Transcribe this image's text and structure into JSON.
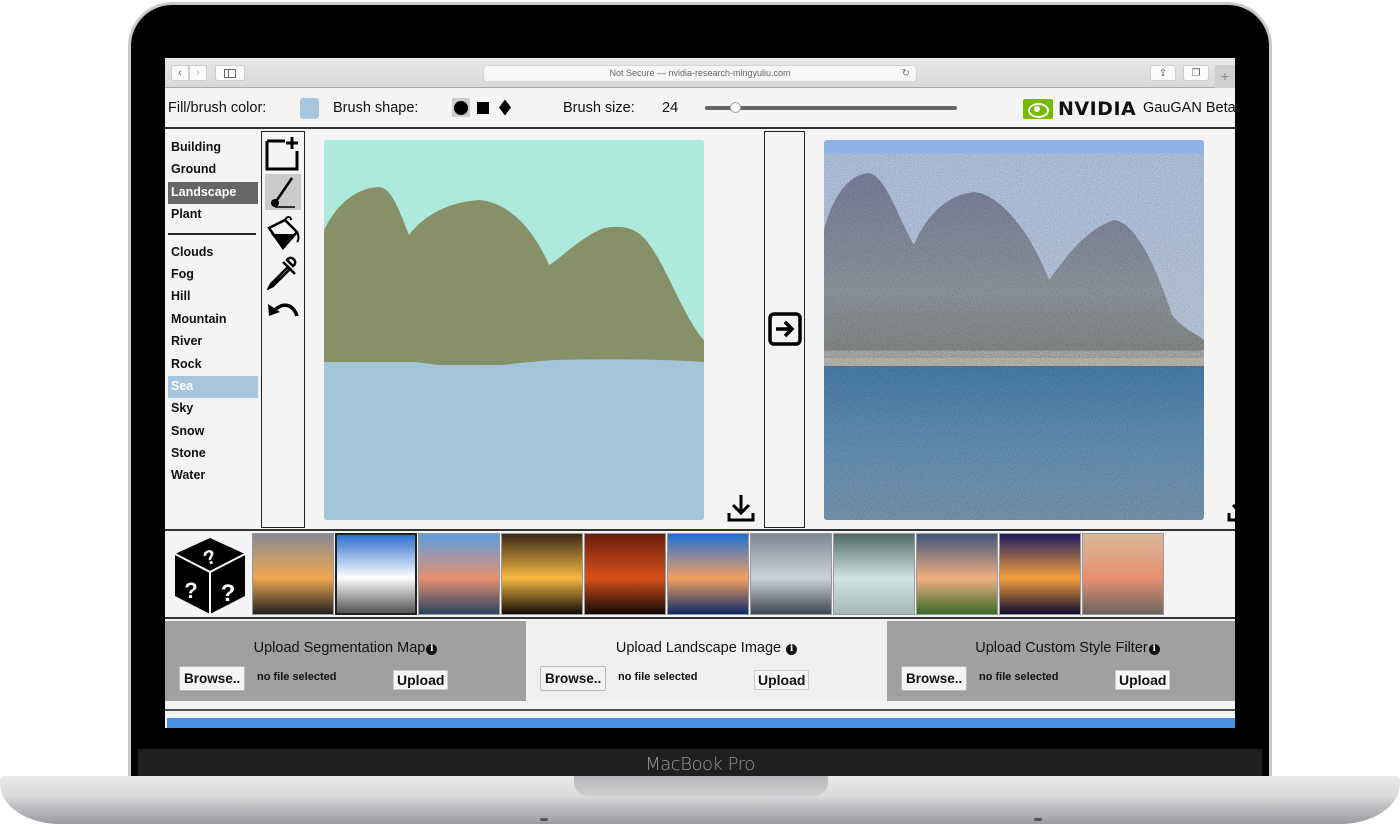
{
  "device": {
    "label": "MacBook Pro"
  },
  "browser": {
    "address": "Not Secure — nvidia-research-mingyuliu.com",
    "back_icon": "chevron-left-icon",
    "forward_icon": "chevron-right-icon",
    "new_tab_label": "+"
  },
  "toolbar": {
    "fill_label": "Fill/brush color:",
    "fill_color": "#a5c6dc",
    "shape_label": "Brush shape:",
    "shapes": [
      "circle",
      "square",
      "diamond"
    ],
    "selected_shape": "circle",
    "size_label": "Brush size:",
    "size_value": "24",
    "size_fraction": 0.12,
    "brand": "NVIDIA",
    "brand_color": "#76b900",
    "app_title": "GauGAN Beta"
  },
  "labels": {
    "group1": [
      {
        "label": "Building"
      },
      {
        "label": "Ground"
      },
      {
        "label": "Landscape",
        "selected": true
      },
      {
        "label": "Plant"
      }
    ],
    "group2": [
      {
        "label": "Clouds"
      },
      {
        "label": "Fog"
      },
      {
        "label": "Hill"
      },
      {
        "label": "Mountain"
      },
      {
        "label": "River"
      },
      {
        "label": "Rock"
      },
      {
        "label": "Sea",
        "selected": true
      },
      {
        "label": "Sky"
      },
      {
        "label": "Snow"
      },
      {
        "label": "Stone"
      },
      {
        "label": "Water"
      }
    ]
  },
  "tools": [
    {
      "name": "new-canvas",
      "icon": "new-canvas-icon"
    },
    {
      "name": "brush",
      "icon": "brush-icon",
      "selected": true
    },
    {
      "name": "fill",
      "icon": "paint-bucket-icon"
    },
    {
      "name": "eyedropper",
      "icon": "eyedropper-icon"
    },
    {
      "name": "undo",
      "icon": "undo-icon"
    }
  ],
  "canvas": {
    "colors": {
      "sky": "#aeeadc",
      "mountain": "#879067",
      "sea": "#a3c5d8"
    }
  },
  "styles": {
    "random_icon": "random-dice-icon",
    "thumbnails": [
      {
        "name": "sunset-trees",
        "colors": [
          "#8a8a95",
          "#f0a850",
          "#222"
        ]
      },
      {
        "name": "road-clouds",
        "colors": [
          "#2f6fd0",
          "#ffffff",
          "#555"
        ],
        "selected": true
      },
      {
        "name": "lake-dusk",
        "colors": [
          "#5b9ee0",
          "#e89070",
          "#29435f"
        ]
      },
      {
        "name": "golden-sunset",
        "colors": [
          "#3a2a18",
          "#f6b940",
          "#100c08"
        ]
      },
      {
        "name": "red-sky",
        "colors": [
          "#6a1a0a",
          "#d8521a",
          "#140808"
        ]
      },
      {
        "name": "cliff-bay",
        "colors": [
          "#1f6ed8",
          "#f3a060",
          "#0e2a68"
        ]
      },
      {
        "name": "grey-beach",
        "colors": [
          "#7d8896",
          "#cdd3dc",
          "#3e4650"
        ]
      },
      {
        "name": "snow-moon",
        "colors": [
          "#516a66",
          "#d0e4e0",
          "#a4b8b6"
        ]
      },
      {
        "name": "pink-clouds",
        "colors": [
          "#40547a",
          "#f0b080",
          "#3c6a2a"
        ]
      },
      {
        "name": "purple-lights",
        "colors": [
          "#1c1a60",
          "#f6a040",
          "#0c0c30"
        ]
      },
      {
        "name": "calm-sea-sunset",
        "colors": [
          "#d8b898",
          "#e89070",
          "#6a6560"
        ]
      }
    ]
  },
  "uploads": [
    {
      "title": "Upload Segmentation Map",
      "browse": "Browse..",
      "status": "no file selected",
      "upload": "Upload",
      "info_icon": "info-icon"
    },
    {
      "title": "Upload Landscape Image",
      "browse": "Browse..",
      "status": "no file selected",
      "upload": "Upload",
      "info_icon": "info-icon"
    },
    {
      "title": "Upload Custom Style Filter",
      "browse": "Browse..",
      "status": "no file selected",
      "upload": "Upload",
      "info_icon": "info-icon"
    }
  ]
}
